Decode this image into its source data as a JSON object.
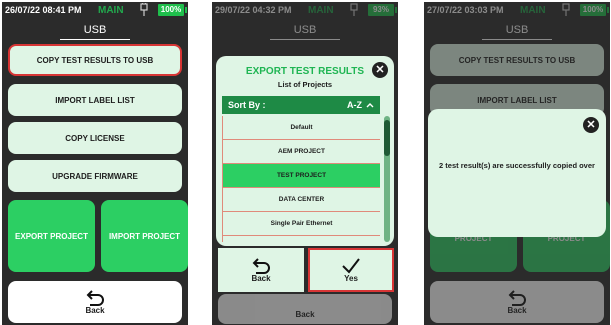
{
  "screen1": {
    "time": "26/07/22 08:41 PM",
    "mode": "MAIN",
    "battery": "100%",
    "title": "USB",
    "buttons": [
      "COPY TEST RESULTS TO USB",
      "IMPORT LABEL LIST",
      "COPY LICENSE",
      "UPGRADE FIRMWARE"
    ],
    "export_label": "EXPORT PROJECT",
    "import_label": "IMPORT PROJECT",
    "back_label": "Back"
  },
  "screen2": {
    "time": "29/07/22 04:32 PM",
    "mode": "MAIN",
    "battery": "93%",
    "title": "USB",
    "dialog_title": "EXPORT TEST RESULTS",
    "dialog_subtitle": "List of Projects",
    "sort_label": "Sort By :",
    "sort_value": "A-Z",
    "projects": [
      "Default",
      "AEM PROJECT",
      "TEST PROJECT",
      "DATA CENTER",
      "Single Pair Ethernet"
    ],
    "selected_project": "TEST PROJECT",
    "back_label": "Back",
    "yes_label": "Yes",
    "behind_back_label": "Back"
  },
  "screen3": {
    "time": "27/07/22 03:03 PM",
    "mode": "MAIN",
    "battery": "100%",
    "title": "USB",
    "bg_button_1": "COPY TEST RESULTS TO USB",
    "bg_button_2": "IMPORT LABEL LIST",
    "bg_left": "PROJECT",
    "bg_right": "PROJECT",
    "message": "2 test result(s) are successfully copied over",
    "back_label": "Back"
  },
  "colors": {
    "accent": "#2ccf63",
    "dark_green": "#1e8a45",
    "highlight": "#d83535",
    "panel": "#dff5e5"
  }
}
